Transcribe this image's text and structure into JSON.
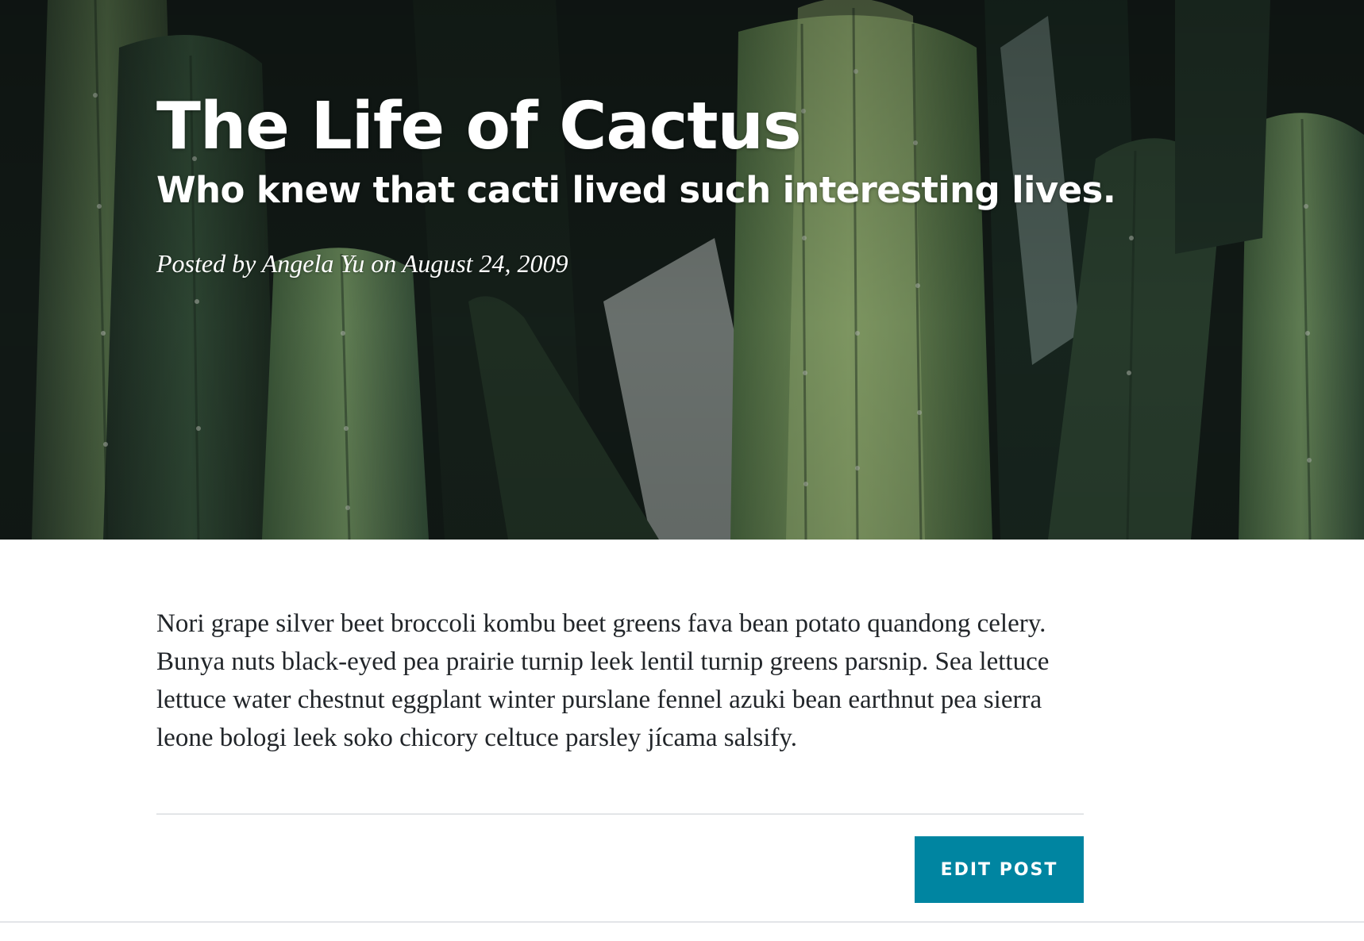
{
  "header": {
    "title": "The Life of Cactus",
    "subtitle": "Who knew that cacti lived such interesting lives.",
    "meta": "Posted by Angela Yu on August 24, 2009"
  },
  "article": {
    "body": "Nori grape silver beet broccoli kombu beet greens fava bean potato quandong celery. Bunya nuts black-eyed pea prairie turnip leek lentil turnip greens parsnip. Sea lettuce lettuce water chestnut eggplant winter purslane fennel azuki bean earthnut pea sierra leone bologi leek soko chicory celtuce parsley jícama salsify."
  },
  "actions": {
    "edit_label": "EDIT POST"
  },
  "colors": {
    "accent": "#0085a1",
    "text": "#212529",
    "divider": "#e3e5e8"
  }
}
